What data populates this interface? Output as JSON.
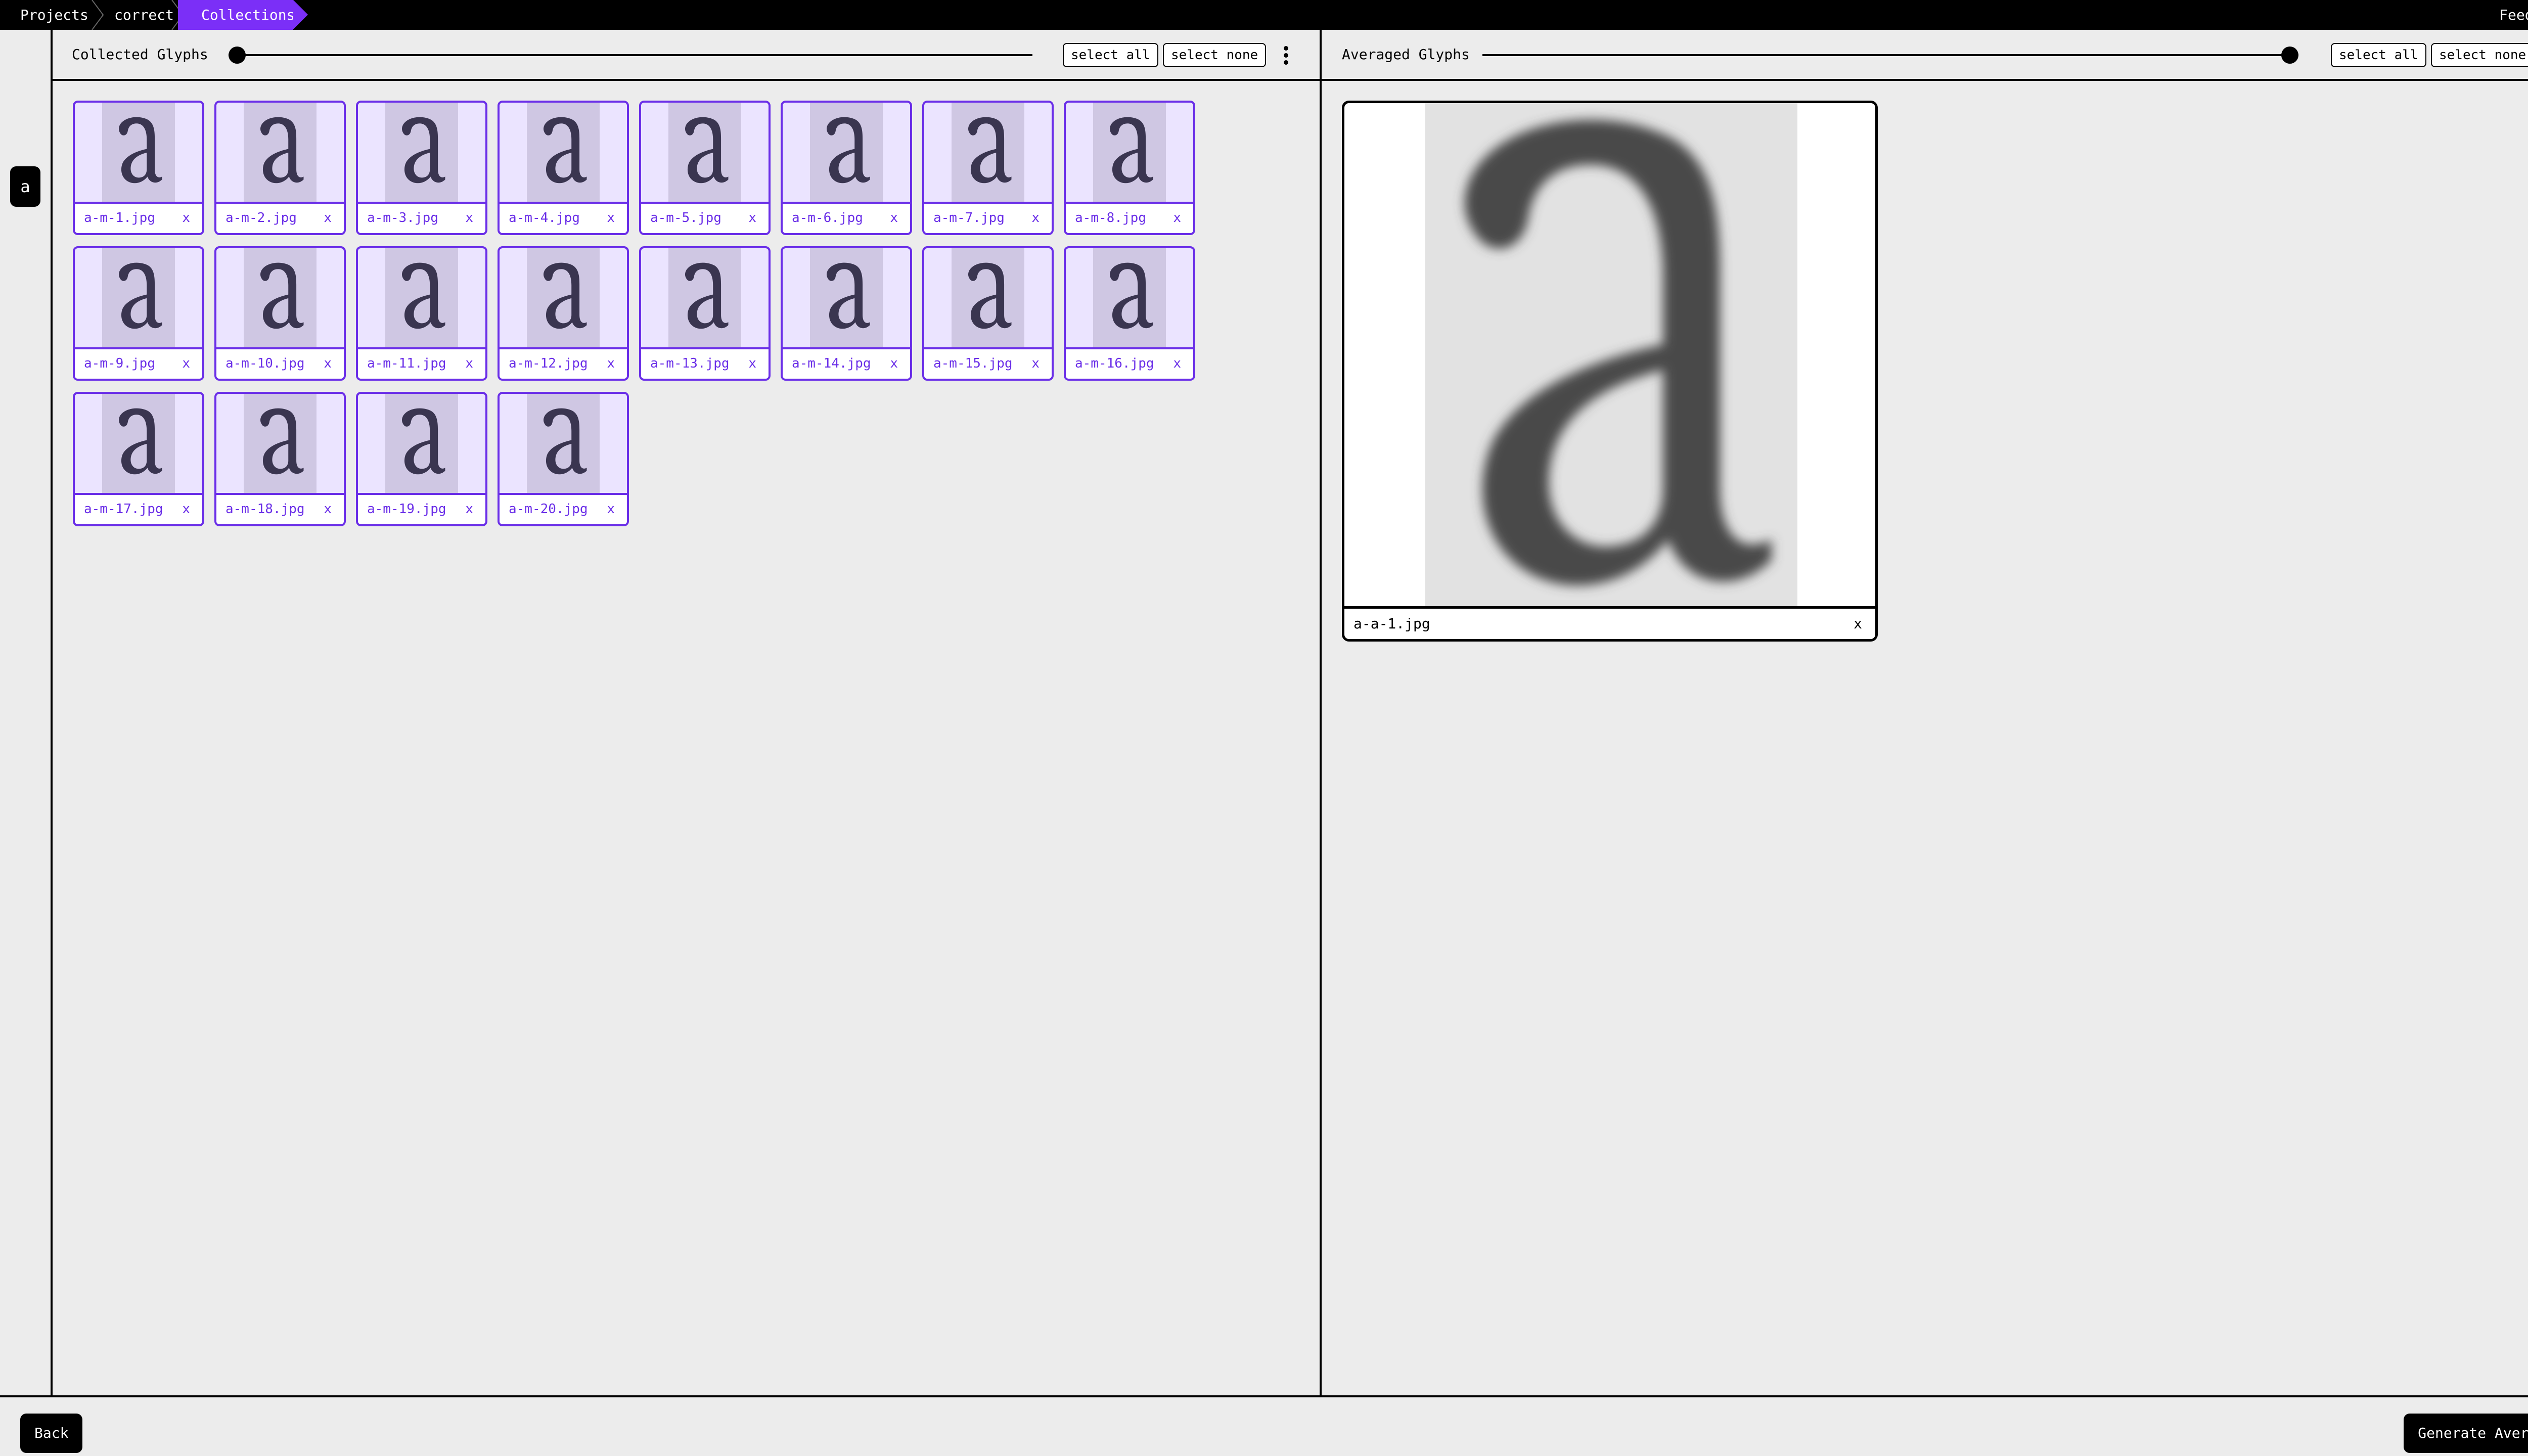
{
  "breadcrumb": {
    "items": [
      "Projects",
      "correct",
      "Collections"
    ]
  },
  "header": {
    "feedback_label": "Feedback"
  },
  "rail": {
    "active_glyph": "a"
  },
  "collected": {
    "title": "Collected Glyphs",
    "slider_value": 0.0,
    "select_all_label": "select all",
    "select_none_label": "select none",
    "menu_icon": "more-vertical-icon",
    "items": [
      {
        "file": "a-m-1.jpg",
        "close": "x"
      },
      {
        "file": "a-m-2.jpg",
        "close": "x"
      },
      {
        "file": "a-m-3.jpg",
        "close": "x"
      },
      {
        "file": "a-m-4.jpg",
        "close": "x"
      },
      {
        "file": "a-m-5.jpg",
        "close": "x"
      },
      {
        "file": "a-m-6.jpg",
        "close": "x"
      },
      {
        "file": "a-m-7.jpg",
        "close": "x"
      },
      {
        "file": "a-m-8.jpg",
        "close": "x"
      },
      {
        "file": "a-m-9.jpg",
        "close": "x"
      },
      {
        "file": "a-m-10.jpg",
        "close": "x"
      },
      {
        "file": "a-m-11.jpg",
        "close": "x"
      },
      {
        "file": "a-m-12.jpg",
        "close": "x"
      },
      {
        "file": "a-m-13.jpg",
        "close": "x"
      },
      {
        "file": "a-m-14.jpg",
        "close": "x"
      },
      {
        "file": "a-m-15.jpg",
        "close": "x"
      },
      {
        "file": "a-m-16.jpg",
        "close": "x"
      },
      {
        "file": "a-m-17.jpg",
        "close": "x"
      },
      {
        "file": "a-m-18.jpg",
        "close": "x"
      },
      {
        "file": "a-m-19.jpg",
        "close": "x"
      },
      {
        "file": "a-m-20.jpg",
        "close": "x"
      }
    ]
  },
  "averaged": {
    "title": "Averaged Glyphs",
    "slider_value": 1.0,
    "select_all_label": "select all",
    "select_none_label": "select none",
    "menu_icon": "more-vertical-icon",
    "items": [
      {
        "file": "a-a-1.jpg",
        "close": "x"
      }
    ]
  },
  "footer": {
    "back_label": "Back",
    "generate_label": "Generate Average"
  },
  "colors": {
    "accent": "#7b2ff7",
    "card_border": "#6a2ee8",
    "card_bg": "#ebe4ff",
    "background": "#ececec",
    "bar": "#000000"
  }
}
